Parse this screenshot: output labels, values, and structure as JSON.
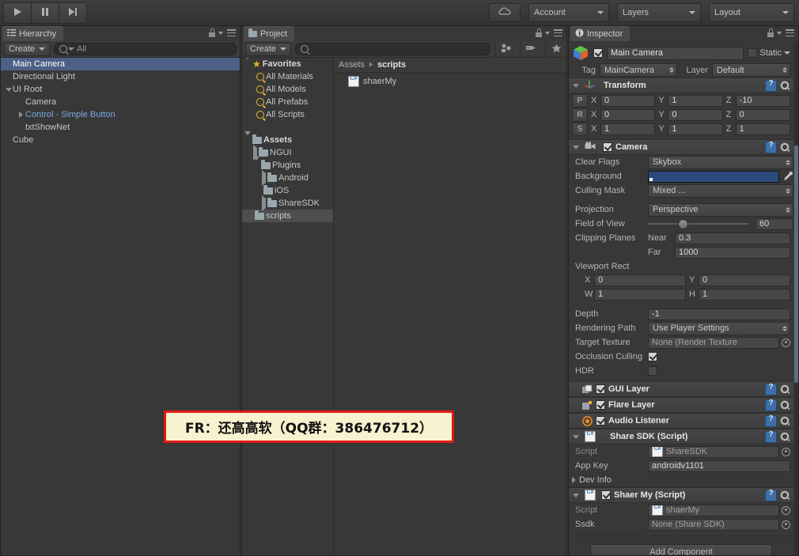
{
  "toolbar": {
    "play_icon": "play-icon",
    "pause_icon": "pause-icon",
    "step_icon": "step-icon",
    "cloud_icon": "cloud-icon",
    "account_label": "Account",
    "layers_label": "Layers",
    "layout_label": "Layout"
  },
  "hierarchy": {
    "tab_label": "Hierarchy",
    "tab_icon": "hierarchy-icon",
    "create_label": "Create",
    "search_value": "All",
    "items": [
      {
        "label": "Main Camera",
        "indent": 0,
        "twirl": "none",
        "selected": true,
        "prefab": false
      },
      {
        "label": "Directional Light",
        "indent": 0,
        "twirl": "none",
        "selected": false,
        "prefab": false
      },
      {
        "label": "UI Root",
        "indent": 0,
        "twirl": "down",
        "selected": false,
        "prefab": false
      },
      {
        "label": "Camera",
        "indent": 1,
        "twirl": "none",
        "selected": false,
        "prefab": false
      },
      {
        "label": "Control - Simple Button",
        "indent": 1,
        "twirl": "right",
        "selected": false,
        "prefab": true
      },
      {
        "label": "txtShowNet",
        "indent": 1,
        "twirl": "none",
        "selected": false,
        "prefab": false
      },
      {
        "label": "Cube",
        "indent": 0,
        "twirl": "none",
        "selected": false,
        "prefab": false
      }
    ]
  },
  "project": {
    "tab_label": "Project",
    "tab_icon": "folder-icon",
    "create_label": "Create",
    "search_value": "",
    "toolbar_icons": [
      "object-filter-icon",
      "label-filter-icon",
      "favorite-star-icon"
    ],
    "tree": [
      {
        "label": "Favorites",
        "indent": 0,
        "twirl": "down",
        "icon": "star",
        "bold": true,
        "selected": false
      },
      {
        "label": "All Materials",
        "indent": 1,
        "twirl": "none",
        "icon": "search",
        "bold": false,
        "selected": false
      },
      {
        "label": "All Models",
        "indent": 1,
        "twirl": "none",
        "icon": "search",
        "bold": false,
        "selected": false
      },
      {
        "label": "All Prefabs",
        "indent": 1,
        "twirl": "none",
        "icon": "search",
        "bold": false,
        "selected": false
      },
      {
        "label": "All Scripts",
        "indent": 1,
        "twirl": "none",
        "icon": "search",
        "bold": false,
        "selected": false
      },
      {
        "label": "",
        "indent": 0,
        "twirl": "none",
        "icon": "none",
        "bold": false,
        "selected": false
      },
      {
        "label": "Assets",
        "indent": 0,
        "twirl": "down",
        "icon": "folder",
        "bold": true,
        "selected": false
      },
      {
        "label": "NGUI",
        "indent": 1,
        "twirl": "right",
        "icon": "folder",
        "bold": false,
        "selected": false
      },
      {
        "label": "Plugins",
        "indent": 1,
        "twirl": "down",
        "icon": "folder",
        "bold": false,
        "selected": false
      },
      {
        "label": "Android",
        "indent": 2,
        "twirl": "right",
        "icon": "folder",
        "bold": false,
        "selected": false
      },
      {
        "label": "iOS",
        "indent": 2,
        "twirl": "none",
        "icon": "folder",
        "bold": false,
        "selected": false
      },
      {
        "label": "ShareSDK",
        "indent": 2,
        "twirl": "right",
        "icon": "folder",
        "bold": false,
        "selected": false
      },
      {
        "label": "scripts",
        "indent": 1,
        "twirl": "none",
        "icon": "folder",
        "bold": false,
        "selected": true
      }
    ],
    "breadcrumb_root": "Assets",
    "breadcrumb_current": "scripts",
    "assets": [
      {
        "label": "shaerMy",
        "icon": "csharp-script-icon"
      }
    ]
  },
  "inspector": {
    "tab_label": "Inspector",
    "tab_icon": "info-icon",
    "gameobject": {
      "icon": "gameobject-cube-icon",
      "enabled": true,
      "name": "Main Camera",
      "static_label": "Static",
      "static_checked": false,
      "tag_label": "Tag",
      "tag_value": "MainCamera",
      "layer_label": "Layer",
      "layer_value": "Default"
    },
    "transform": {
      "title": "Transform",
      "icon": "transform-axis-icon",
      "rows": [
        {
          "btn": "P",
          "x": "0",
          "y": "1",
          "z": "-10"
        },
        {
          "btn": "R",
          "x": "0",
          "y": "0",
          "z": "0"
        },
        {
          "btn": "S",
          "x": "1",
          "y": "1",
          "z": "1"
        }
      ],
      "axis_labels": [
        "X",
        "Y",
        "Z"
      ]
    },
    "camera": {
      "title": "Camera",
      "icon": "camera-icon",
      "enabled": true,
      "clear_flags_label": "Clear Flags",
      "clear_flags_value": "Skybox",
      "background_label": "Background",
      "background_color": "#2c4b7c",
      "culling_mask_label": "Culling Mask",
      "culling_mask_value": "Mixed ...",
      "projection_label": "Projection",
      "projection_value": "Perspective",
      "fov_label": "Field of View",
      "fov_value": "60",
      "clipping_label": "Clipping Planes",
      "near_label": "Near",
      "near_value": "0.3",
      "far_label": "Far",
      "far_value": "1000",
      "viewport_label": "Viewport Rect",
      "viewport_x_label": "X",
      "viewport_x": "0",
      "viewport_y_label": "Y",
      "viewport_y": "0",
      "viewport_w_label": "W",
      "viewport_w": "1",
      "viewport_h_label": "H",
      "viewport_h": "1",
      "depth_label": "Depth",
      "depth_value": "-1",
      "rendering_path_label": "Rendering Path",
      "rendering_path_value": "Use Player Settings",
      "target_texture_label": "Target Texture",
      "target_texture_value": "None (Render Texture",
      "occlusion_label": "Occlusion Culling",
      "occlusion_checked": true,
      "hdr_label": "HDR",
      "hdr_checked": false
    },
    "gui_layer": {
      "title": "GUI Layer",
      "icon": "gui-layer-icon",
      "enabled": true
    },
    "flare_layer": {
      "title": "Flare Layer",
      "icon": "flare-layer-icon",
      "enabled": true
    },
    "audio_listener": {
      "title": "Audio Listener",
      "icon": "audio-listener-icon",
      "enabled": true
    },
    "share_sdk": {
      "title": "Share SDK (Script)",
      "icon": "csharp-script-icon",
      "script_label": "Script",
      "script_value": "ShareSDK",
      "appkey_label": "App Key",
      "appkey_value": "androidv1101",
      "devinfo_label": "Dev Info"
    },
    "shaer_my": {
      "title": "Shaer My (Script)",
      "icon": "csharp-script-icon",
      "enabled": true,
      "script_label": "Script",
      "script_value": "shaerMy",
      "ssdk_label": "Ssdk",
      "ssdk_value": "None (Share SDK)"
    },
    "add_component_label": "Add Component"
  },
  "watermark": {
    "text": "FR：还高高软（QQ群：386476712）",
    "border_color": "#e01b14",
    "background_color": "#f7f2cf"
  }
}
